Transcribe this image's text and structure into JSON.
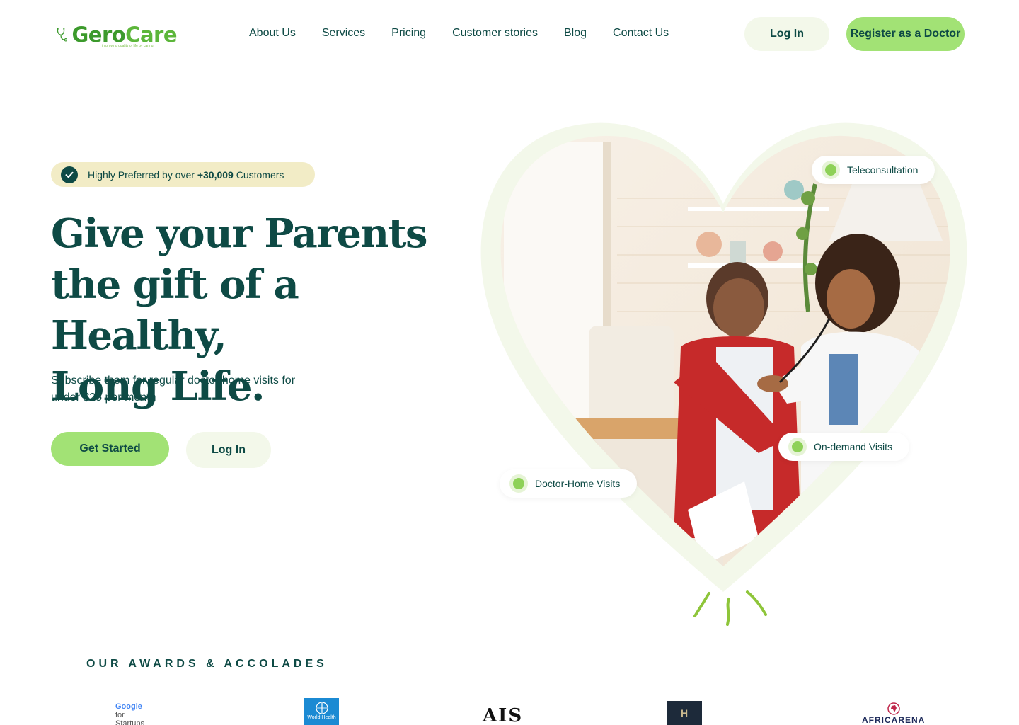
{
  "header": {
    "logo_text_a": "Gero",
    "logo_text_b": "Care",
    "logo_tagline": "improving quality of life by caring",
    "nav": [
      "About Us",
      "Services",
      "Pricing",
      "Customer stories",
      "Blog",
      "Contact Us"
    ],
    "login_label": "Log In",
    "register_label": "Register as a Doctor"
  },
  "hero": {
    "badge_prefix": "Highly Preferred by over ",
    "badge_count": "+30,009",
    "badge_suffix": " Customers",
    "title_line1": "Give your Parents",
    "title_line2": "the gift of a Healthy,",
    "title_line3": "Long Life.",
    "subtitle": "Subscribe them for regular doctor home visits for under $25 per month",
    "cta_primary": "Get Started",
    "cta_secondary": "Log In"
  },
  "features": {
    "teleconsultation": "Teleconsultation",
    "on_demand": "On-demand Visits",
    "home_visits": "Doctor-Home Visits"
  },
  "awards": {
    "title": "OUR AWARDS & ACCOLADES",
    "items": [
      {
        "name": "Google for Startups",
        "line1": "Google",
        "line2": "for",
        "line3": "Startups"
      },
      {
        "name": "World Health Organization",
        "line1": "World Health"
      },
      {
        "name": "AIS",
        "line1": "AIS"
      },
      {
        "name": "H",
        "line1": "H"
      },
      {
        "name": "AfricArena",
        "line1": "AFRICARENA"
      }
    ]
  },
  "colors": {
    "primary": "#0e4a45",
    "accent": "#a2e275",
    "soft": "#f3f8ea",
    "badge": "#f2ecc6"
  }
}
